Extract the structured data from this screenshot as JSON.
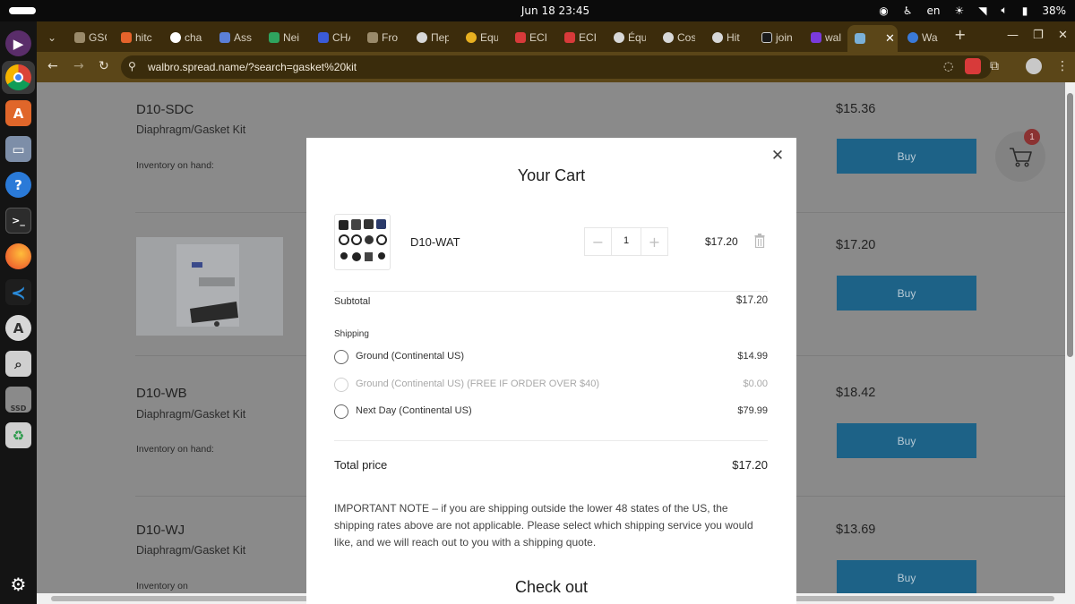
{
  "system": {
    "clock": "Jun 18  23:45",
    "language": "en",
    "battery": "38%"
  },
  "browser": {
    "tabs": [
      {
        "label": "GSC",
        "color": "#9a8a6a"
      },
      {
        "label": "hitc",
        "color": "#e5632b"
      },
      {
        "label": "cha",
        "color": "#ffffff"
      },
      {
        "label": "Ass",
        "color": "#5b7fd6"
      },
      {
        "label": "Nei",
        "color": "#2fa35e"
      },
      {
        "label": "CHA",
        "color": "#3a5bd8"
      },
      {
        "label": "Fro",
        "color": "#9a8a6a"
      },
      {
        "label": "Пер",
        "color": "#d8d8d8"
      },
      {
        "label": "Equ",
        "color": "#e8b020"
      },
      {
        "label": "ECI",
        "color": "#d83a3a"
      },
      {
        "label": "ECI",
        "color": "#d83a3a"
      },
      {
        "label": "Équ",
        "color": "#d8d8d8"
      },
      {
        "label": "Cos",
        "color": "#d8d8d8"
      },
      {
        "label": "Hit",
        "color": "#d8d8d8"
      },
      {
        "label": "join",
        "color": "#1a1a1a"
      },
      {
        "label": "wal",
        "color": "#7a3adb"
      },
      {
        "label": "",
        "color": "#7ab0d8",
        "active": true
      },
      {
        "label": "Wa",
        "color": "#3a7ad8"
      }
    ],
    "url": "walbro.spread.name/?search=gasket%20kit"
  },
  "products": [
    {
      "code": "D10-SDC",
      "desc": "Diaphragm/Gasket Kit",
      "inventory": "Inventory on hand:",
      "price": "$15.36",
      "buy": "Buy"
    },
    {
      "code": "",
      "desc": "",
      "inventory": "",
      "price": "$17.20",
      "buy": "Buy"
    },
    {
      "code": "D10-WB",
      "desc": "Diaphragm/Gasket Kit",
      "inventory": "Inventory on hand:",
      "price": "$18.42",
      "buy": "Buy"
    },
    {
      "code": "D10-WJ",
      "desc": "Diaphragm/Gasket Kit",
      "inventory": "Inventory on",
      "price": "$13.69",
      "buy": "Buy"
    }
  ],
  "cart_badge": "1",
  "cart": {
    "title": "Your Cart",
    "item": {
      "name": "D10-WAT",
      "qty": "1",
      "price": "$17.20"
    },
    "subtotal_label": "Subtotal",
    "subtotal": "$17.20",
    "shipping_label": "Shipping",
    "shipping_options": [
      {
        "label": "Ground (Continental US)",
        "price": "$14.99",
        "disabled": false
      },
      {
        "label": "Ground (Continental US) (FREE IF ORDER OVER $40)",
        "price": "$0.00",
        "disabled": true
      },
      {
        "label": "Next Day (Continental US)",
        "price": "$79.99",
        "disabled": false
      }
    ],
    "total_label": "Total price",
    "total": "$17.20",
    "note": "IMPORTANT NOTE – if you are shipping outside the lower 48 states of the US, the shipping rates above are not applicable. Please select which shipping service you would like, and we will reach out to you with a shipping quote.",
    "checkout": "Check out"
  }
}
